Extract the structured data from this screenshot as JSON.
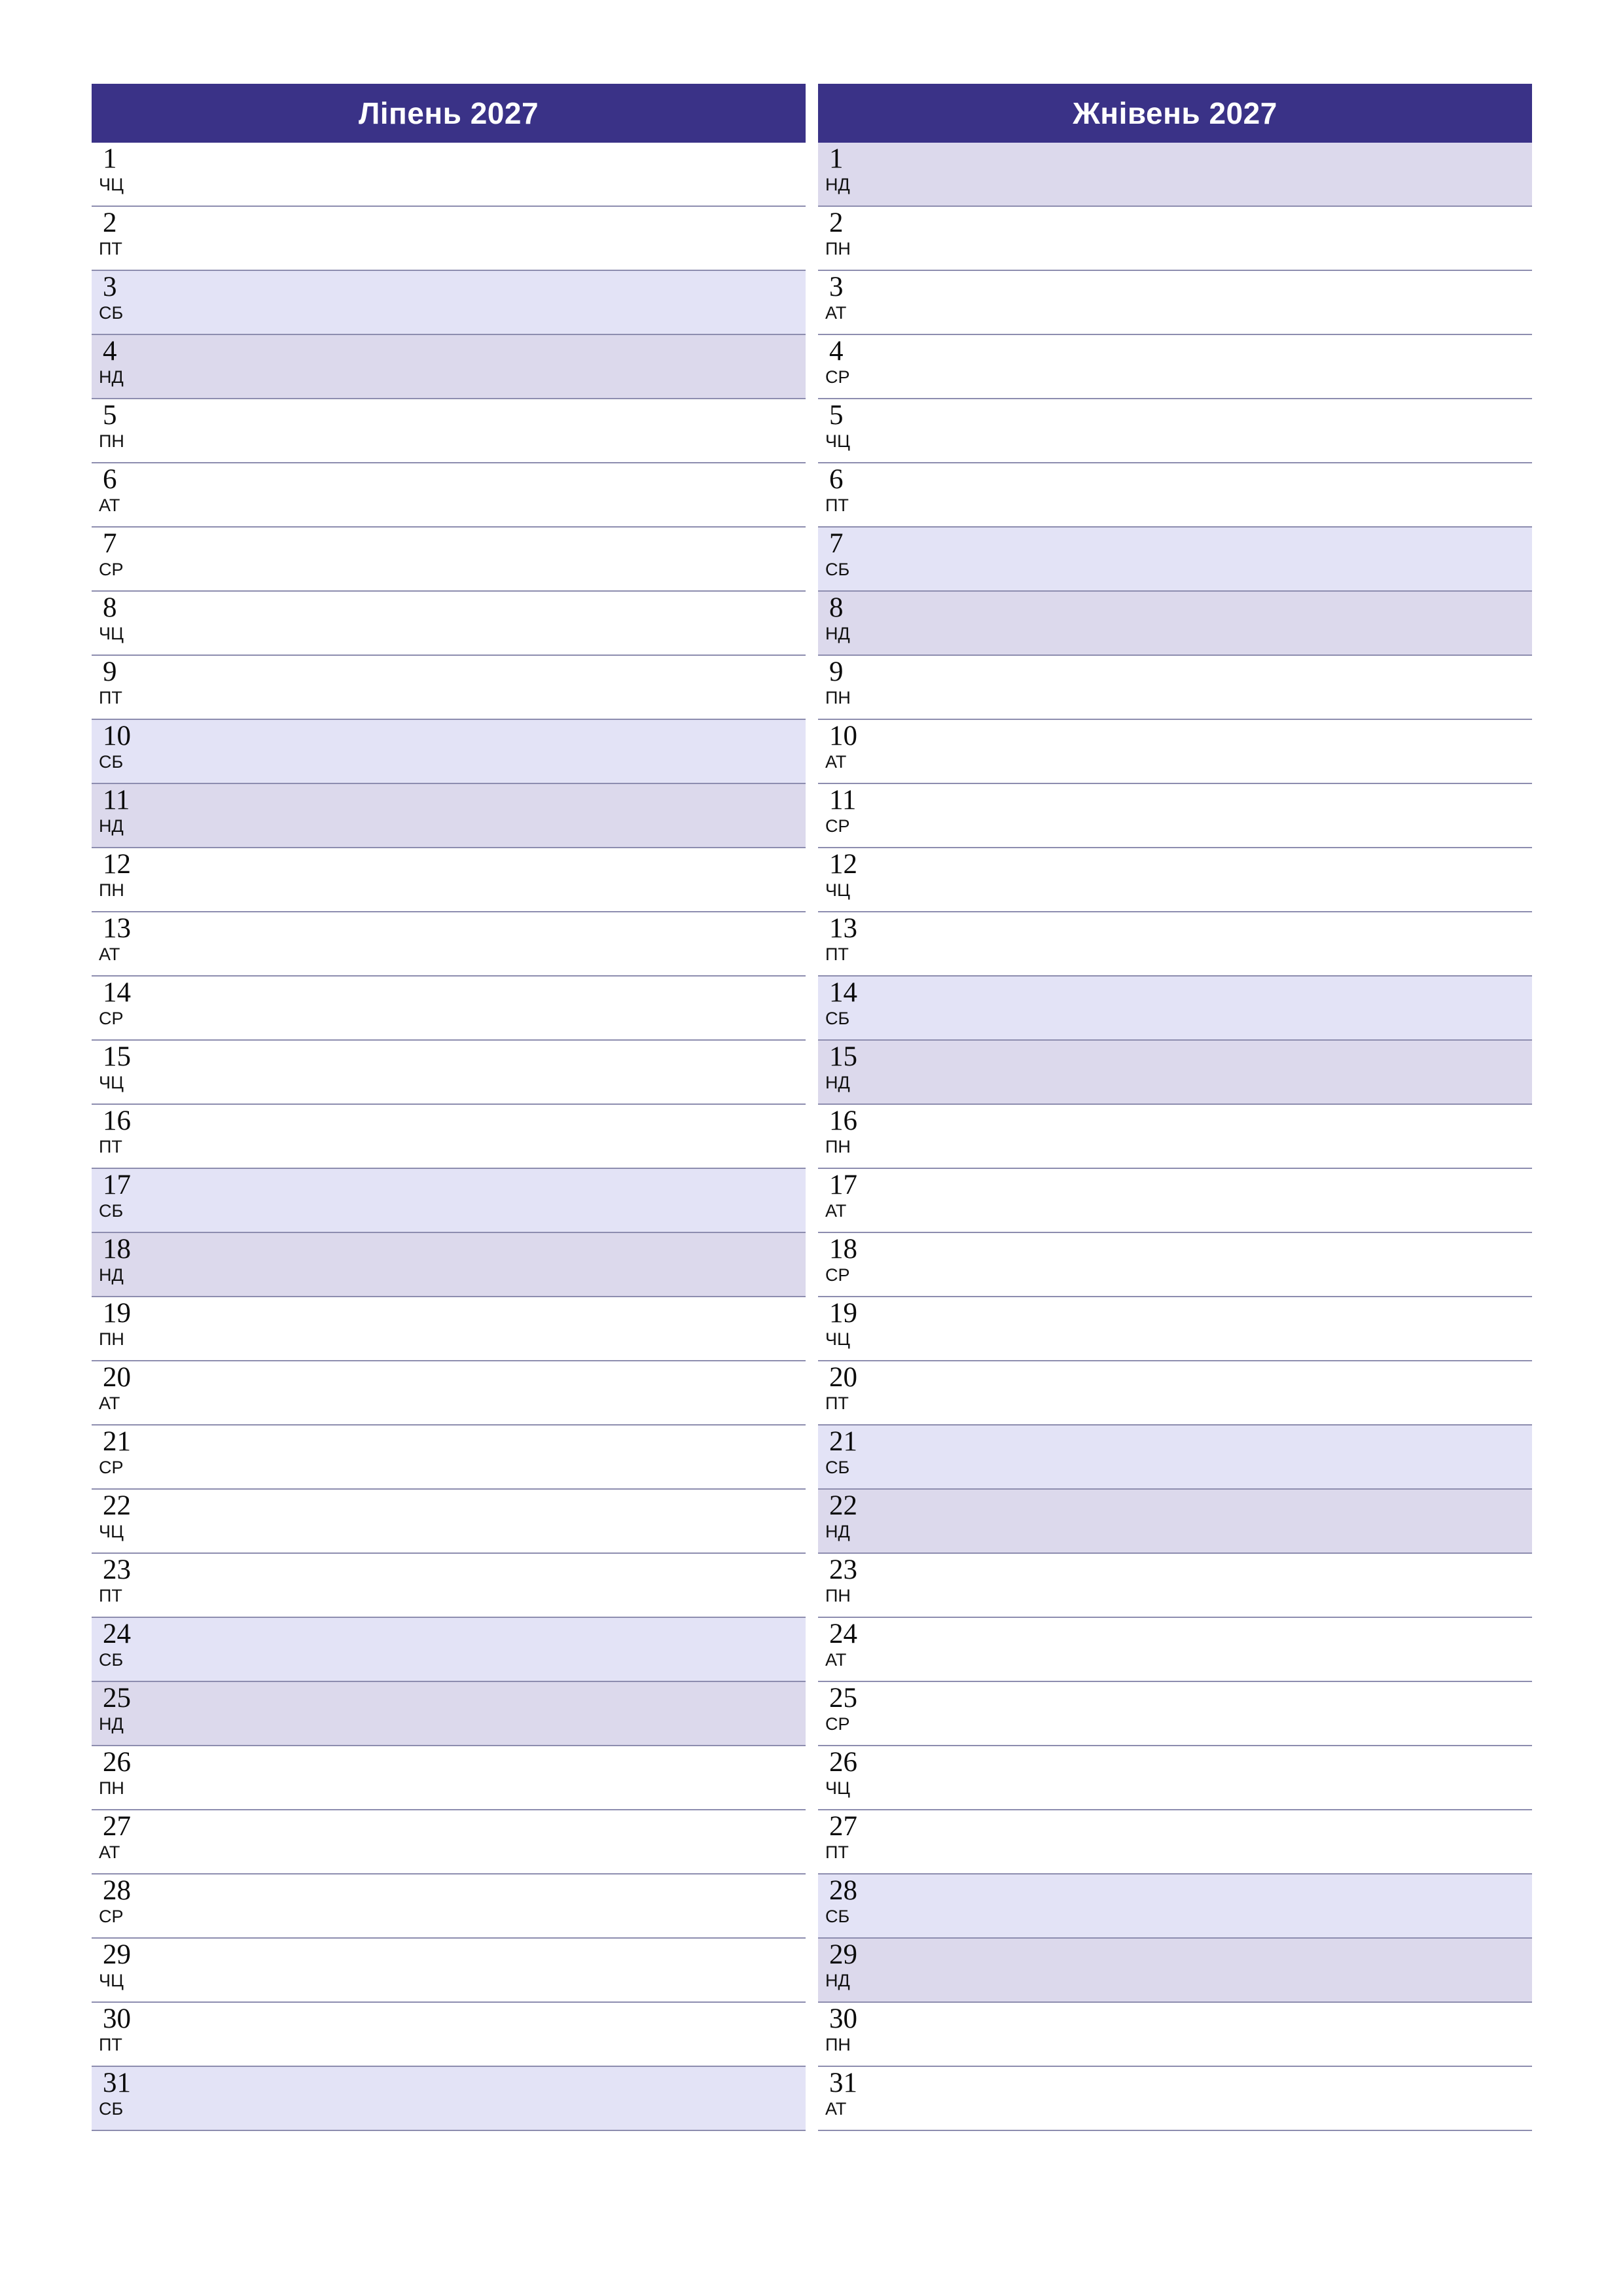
{
  "page": {
    "type": "monthly-planner",
    "layout": "two-month-columns",
    "language": "be",
    "background_color": "#ffffff"
  },
  "theme": {
    "header_background": "#3a3287",
    "header_text_color": "#ffffff",
    "saturday_background": "#e3e3f6",
    "sunday_background": "#dcd9ec",
    "weekday_background": "#ffffff",
    "row_separator_color": "#8d8daf",
    "text_color": "#0b0b0b"
  },
  "months": [
    {
      "title": "Ліпень 2027",
      "name": "Ліпень",
      "year": "2027",
      "days": [
        {
          "number": "1",
          "abbr": "ЧЦ",
          "type": "weekday"
        },
        {
          "number": "2",
          "abbr": "ПТ",
          "type": "weekday"
        },
        {
          "number": "3",
          "abbr": "СБ",
          "type": "saturday"
        },
        {
          "number": "4",
          "abbr": "НД",
          "type": "sunday"
        },
        {
          "number": "5",
          "abbr": "ПН",
          "type": "weekday"
        },
        {
          "number": "6",
          "abbr": "АТ",
          "type": "weekday"
        },
        {
          "number": "7",
          "abbr": "СР",
          "type": "weekday"
        },
        {
          "number": "8",
          "abbr": "ЧЦ",
          "type": "weekday"
        },
        {
          "number": "9",
          "abbr": "ПТ",
          "type": "weekday"
        },
        {
          "number": "10",
          "abbr": "СБ",
          "type": "saturday"
        },
        {
          "number": "11",
          "abbr": "НД",
          "type": "sunday"
        },
        {
          "number": "12",
          "abbr": "ПН",
          "type": "weekday"
        },
        {
          "number": "13",
          "abbr": "АТ",
          "type": "weekday"
        },
        {
          "number": "14",
          "abbr": "СР",
          "type": "weekday"
        },
        {
          "number": "15",
          "abbr": "ЧЦ",
          "type": "weekday"
        },
        {
          "number": "16",
          "abbr": "ПТ",
          "type": "weekday"
        },
        {
          "number": "17",
          "abbr": "СБ",
          "type": "saturday"
        },
        {
          "number": "18",
          "abbr": "НД",
          "type": "sunday"
        },
        {
          "number": "19",
          "abbr": "ПН",
          "type": "weekday"
        },
        {
          "number": "20",
          "abbr": "АТ",
          "type": "weekday"
        },
        {
          "number": "21",
          "abbr": "СР",
          "type": "weekday"
        },
        {
          "number": "22",
          "abbr": "ЧЦ",
          "type": "weekday"
        },
        {
          "number": "23",
          "abbr": "ПТ",
          "type": "weekday"
        },
        {
          "number": "24",
          "abbr": "СБ",
          "type": "saturday"
        },
        {
          "number": "25",
          "abbr": "НД",
          "type": "sunday"
        },
        {
          "number": "26",
          "abbr": "ПН",
          "type": "weekday"
        },
        {
          "number": "27",
          "abbr": "АТ",
          "type": "weekday"
        },
        {
          "number": "28",
          "abbr": "СР",
          "type": "weekday"
        },
        {
          "number": "29",
          "abbr": "ЧЦ",
          "type": "weekday"
        },
        {
          "number": "30",
          "abbr": "ПТ",
          "type": "weekday"
        },
        {
          "number": "31",
          "abbr": "СБ",
          "type": "saturday"
        }
      ]
    },
    {
      "title": "Жнівень 2027",
      "name": "Жнівень",
      "year": "2027",
      "days": [
        {
          "number": "1",
          "abbr": "НД",
          "type": "sunday"
        },
        {
          "number": "2",
          "abbr": "ПН",
          "type": "weekday"
        },
        {
          "number": "3",
          "abbr": "АТ",
          "type": "weekday"
        },
        {
          "number": "4",
          "abbr": "СР",
          "type": "weekday"
        },
        {
          "number": "5",
          "abbr": "ЧЦ",
          "type": "weekday"
        },
        {
          "number": "6",
          "abbr": "ПТ",
          "type": "weekday"
        },
        {
          "number": "7",
          "abbr": "СБ",
          "type": "saturday"
        },
        {
          "number": "8",
          "abbr": "НД",
          "type": "sunday"
        },
        {
          "number": "9",
          "abbr": "ПН",
          "type": "weekday"
        },
        {
          "number": "10",
          "abbr": "АТ",
          "type": "weekday"
        },
        {
          "number": "11",
          "abbr": "СР",
          "type": "weekday"
        },
        {
          "number": "12",
          "abbr": "ЧЦ",
          "type": "weekday"
        },
        {
          "number": "13",
          "abbr": "ПТ",
          "type": "weekday"
        },
        {
          "number": "14",
          "abbr": "СБ",
          "type": "saturday"
        },
        {
          "number": "15",
          "abbr": "НД",
          "type": "sunday"
        },
        {
          "number": "16",
          "abbr": "ПН",
          "type": "weekday"
        },
        {
          "number": "17",
          "abbr": "АТ",
          "type": "weekday"
        },
        {
          "number": "18",
          "abbr": "СР",
          "type": "weekday"
        },
        {
          "number": "19",
          "abbr": "ЧЦ",
          "type": "weekday"
        },
        {
          "number": "20",
          "abbr": "ПТ",
          "type": "weekday"
        },
        {
          "number": "21",
          "abbr": "СБ",
          "type": "saturday"
        },
        {
          "number": "22",
          "abbr": "НД",
          "type": "sunday"
        },
        {
          "number": "23",
          "abbr": "ПН",
          "type": "weekday"
        },
        {
          "number": "24",
          "abbr": "АТ",
          "type": "weekday"
        },
        {
          "number": "25",
          "abbr": "СР",
          "type": "weekday"
        },
        {
          "number": "26",
          "abbr": "ЧЦ",
          "type": "weekday"
        },
        {
          "number": "27",
          "abbr": "ПТ",
          "type": "weekday"
        },
        {
          "number": "28",
          "abbr": "СБ",
          "type": "saturday"
        },
        {
          "number": "29",
          "abbr": "НД",
          "type": "sunday"
        },
        {
          "number": "30",
          "abbr": "ПН",
          "type": "weekday"
        },
        {
          "number": "31",
          "abbr": "АТ",
          "type": "weekday"
        }
      ]
    }
  ]
}
